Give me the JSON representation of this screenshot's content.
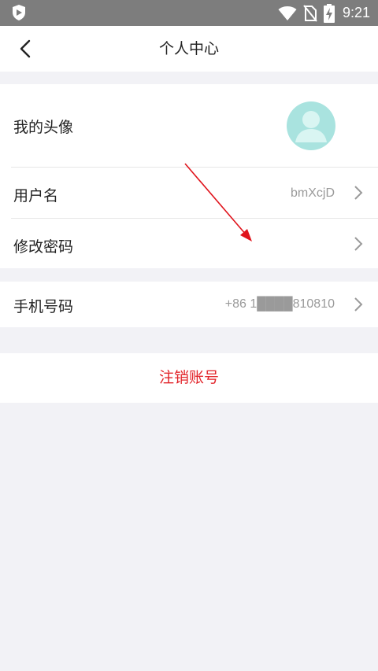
{
  "status_bar": {
    "time": "9:21",
    "icons": [
      "shield-icon",
      "wifi-icon",
      "no-sim-icon",
      "battery-charging-icon"
    ]
  },
  "header": {
    "title": "个人中心",
    "back_icon": "back-arrow-icon"
  },
  "profile": {
    "avatar_label": "我的头像",
    "username_label": "用户名",
    "username_value": "bmXcjD",
    "change_password_label": "修改密码"
  },
  "contact": {
    "phone_label": "手机号码",
    "phone_value": "+86 1████810810"
  },
  "account": {
    "logout_label": "注销账号",
    "logout_color": "#e2242a"
  },
  "colors": {
    "background": "#f2f2f6",
    "avatar_bg": "#a9e3df",
    "annotation_arrow": "#e0141c"
  }
}
